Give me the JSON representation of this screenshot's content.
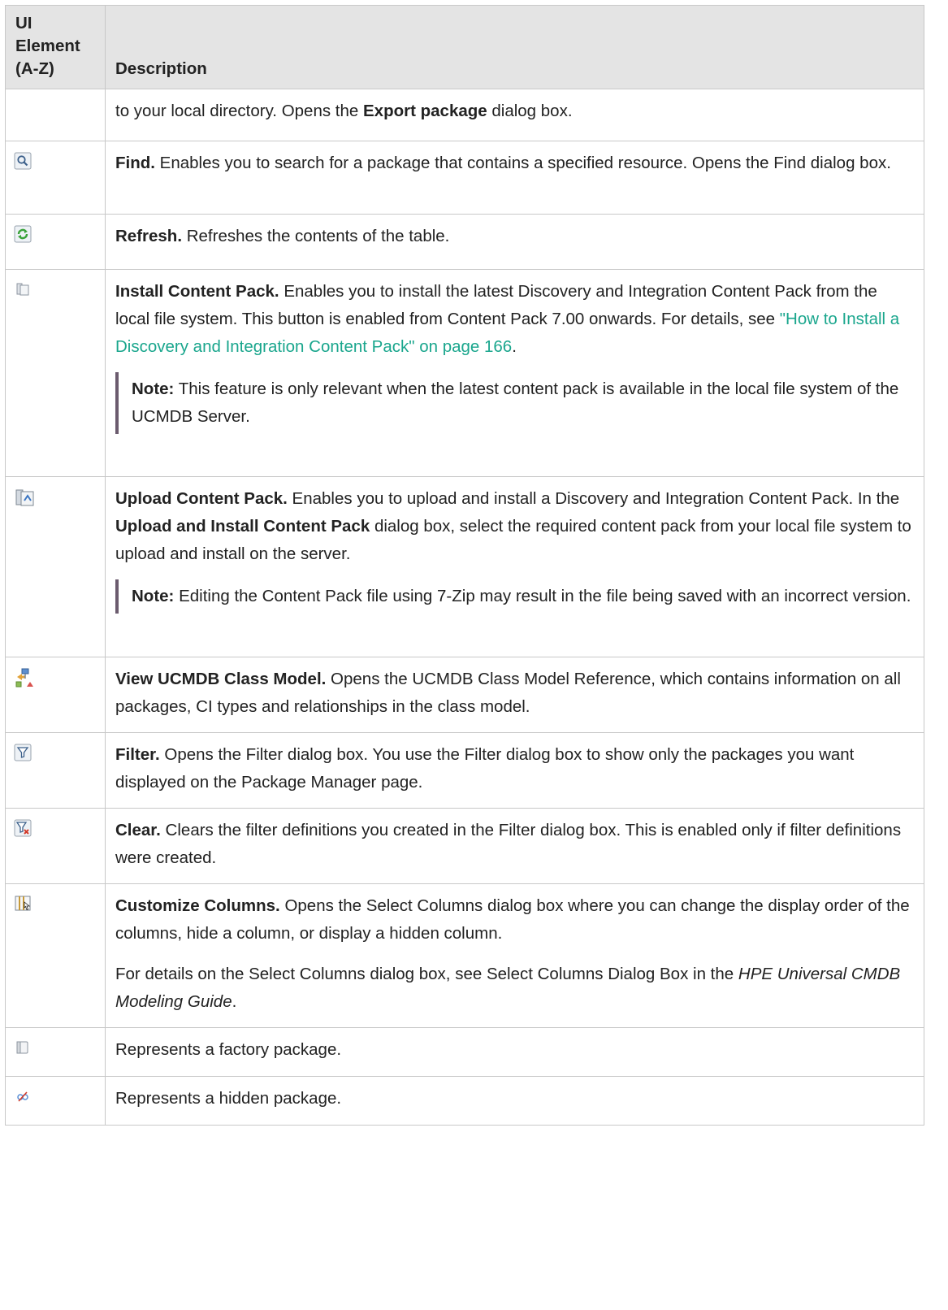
{
  "header": {
    "col1": "UI Element\n(A-Z)",
    "col1_line1": "UI Element",
    "col1_line2": "(A-Z)",
    "col2": "Description"
  },
  "rows": {
    "export": {
      "text1": "to your local directory. Opens the ",
      "bold": "Export package",
      "text2": " dialog box."
    },
    "find": {
      "icon": "magnifier-icon",
      "title": "Find.",
      "text": " Enables you to search for a package that contains a specified resource. Opens the Find dialog box."
    },
    "refresh": {
      "icon": "refresh-icon",
      "title": "Refresh.",
      "text": " Refreshes the contents of the table."
    },
    "install": {
      "icon": "install-content-pack-icon",
      "title": "Install Content Pack.",
      "text": " Enables you to install the latest Discovery and Integration Content Pack from the local file system. This button is enabled from Content Pack 7.00 onwards. For details, see ",
      "link": "\"How to Install a Discovery and Integration Content Pack\" on page 166",
      "after": ".",
      "note_label": "Note:",
      "note_text": "  This feature is only relevant when the latest content pack is available in the local file system of the UCMDB Server."
    },
    "upload": {
      "icon": "upload-content-pack-icon",
      "title": "Upload Content Pack.",
      "text1": " Enables you to upload and install a Discovery and Integration Content Pack. In the ",
      "bold": "Upload and Install Content Pack",
      "text2": " dialog box, select the required content pack from your local file system to upload and install on the server.",
      "note_label": "Note:",
      "note_text": "  Editing the Content Pack file using 7-Zip may result in the file being saved with an incorrect version."
    },
    "classmodel": {
      "icon": "class-model-icon",
      "title": "View UCMDB Class Model.",
      "text": " Opens the UCMDB Class Model Reference, which contains information on all packages, CI types and relationships in the class model."
    },
    "filter": {
      "icon": "filter-icon",
      "title": "Filter.",
      "text": " Opens the Filter dialog box. You use the Filter dialog box to show only the packages you want displayed on the Package Manager page."
    },
    "clear": {
      "icon": "clear-filter-icon",
      "title": "Clear.",
      "text": " Clears the filter definitions you created in the Filter dialog box. This is enabled only if filter definitions were created."
    },
    "columns": {
      "icon": "customize-columns-icon",
      "title": "Customize Columns.",
      "text": " Opens the Select Columns dialog box where you can change the display order of the columns, hide a column, or display a hidden column.",
      "p2_text": "For details on the Select Columns dialog box, see Select Columns Dialog Box in the ",
      "p2_italic": "HPE Universal CMDB Modeling Guide",
      "p2_after": "."
    },
    "factory": {
      "icon": "factory-package-icon",
      "text": "Represents a factory package."
    },
    "hidden": {
      "icon": "hidden-package-icon",
      "text": "Represents a hidden package."
    }
  },
  "colors": {
    "header_bg": "#e4e4e4",
    "border": "#c8c8c8",
    "link": "#1aa68d",
    "note_bar": "#6b5b6e"
  }
}
